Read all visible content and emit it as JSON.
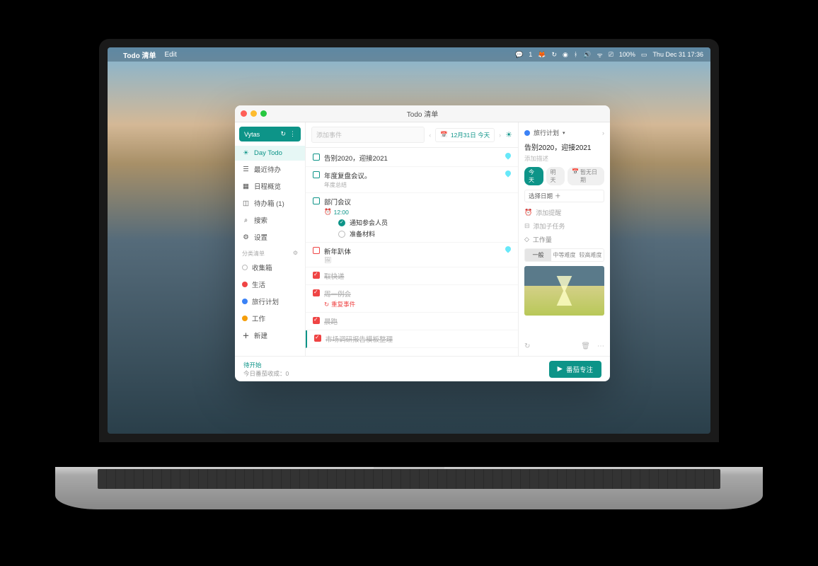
{
  "menubar": {
    "app_name": "Todo 清单",
    "edit": "Edit",
    "battery": "100%",
    "datetime": "Thu Dec 31  17:36",
    "badge": "1"
  },
  "window": {
    "title": "Todo 清单"
  },
  "sidebar": {
    "user": "Vytas",
    "nav": [
      {
        "label": "Day Todo",
        "icon": "sun"
      },
      {
        "label": "最近待办",
        "icon": "calendar"
      },
      {
        "label": "日程概览",
        "icon": "grid"
      },
      {
        "label": "待办箱  (1)",
        "icon": "inbox"
      },
      {
        "label": "搜索",
        "icon": "search"
      },
      {
        "label": "设置",
        "icon": "gear"
      }
    ],
    "section": "分类清单",
    "lists": [
      {
        "label": "收集箱",
        "color": "#ffffff",
        "border": "#bbb"
      },
      {
        "label": "生活",
        "color": "#ef4444"
      },
      {
        "label": "旅行计划",
        "color": "#3b82f6"
      },
      {
        "label": "工作",
        "color": "#f59e0b"
      },
      {
        "label": "新建",
        "color": "#555",
        "plus": true
      }
    ]
  },
  "toolbar": {
    "add_placeholder": "添加事件",
    "date_label": "12月31日 今天"
  },
  "tasks": [
    {
      "title": "告别2020，迎接2021",
      "droplet": true
    },
    {
      "title": "年度复盘会议。",
      "sub": "年度总结",
      "droplet": true
    },
    {
      "title": "部门会议",
      "time": "12:00",
      "subtasks": [
        {
          "label": "通知参会人员",
          "done": true
        },
        {
          "label": "准备材料",
          "done": false
        }
      ]
    },
    {
      "title": "新年趴体",
      "droplet": true,
      "image": true,
      "red": true
    },
    {
      "title": "取快递",
      "done": true,
      "red": true
    },
    {
      "title": "周一例会",
      "done": true,
      "red": true,
      "repeat": "重复事件"
    },
    {
      "title": "晨跑",
      "done": true,
      "red": true
    },
    {
      "title": "市场调研报告模板整理",
      "done": true,
      "red": true,
      "accent": true
    }
  ],
  "detail": {
    "list": "旅行计划",
    "title": "告别2020，迎接2021",
    "desc": "添加描述",
    "chips": [
      "今天",
      "明天",
      "暂无日期"
    ],
    "select_date": "选择日期",
    "reminder": "添加提醒",
    "subtask": "添加子任务",
    "workload": "工作量",
    "workload_opts": [
      "一般",
      "中等难度",
      "较高难度"
    ]
  },
  "footer": {
    "line1": "待开始",
    "line2": "今日番茄收成：0",
    "pomo": "番茄专注"
  }
}
